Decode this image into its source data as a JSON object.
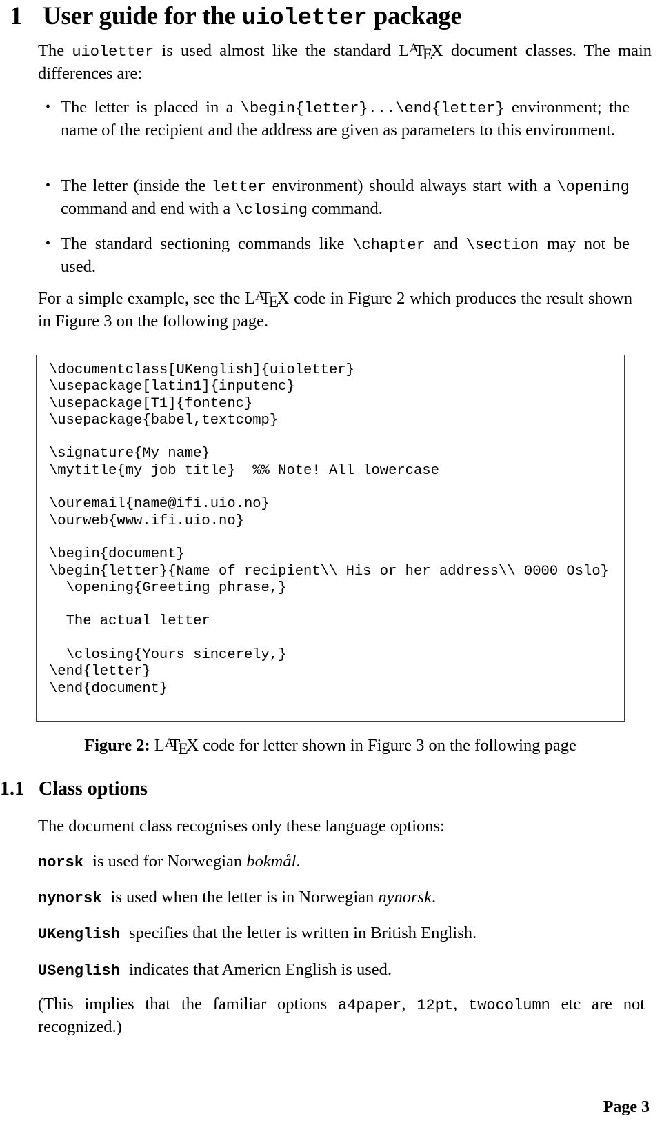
{
  "document": {
    "section": {
      "number": "1",
      "title_before": "User guide for the ",
      "title_mono": "uioletter",
      "title_after": " package"
    },
    "intro_paragraph": {
      "t1": "The ",
      "mono1": "uioletter",
      "t2": " is used almost like the standard ",
      "latex": "LaTeX",
      "t3": " document classes. The main differences are:"
    },
    "bullets": [
      {
        "t1": "The letter is placed in a ",
        "mono1": "\\begin{letter}...\\end{letter}",
        "t2": " environment; the name of the recipient and the address are given as parameters to this environment."
      },
      {
        "t1": "The letter (inside the ",
        "mono1": "letter",
        "t2": " environment) should always start with a ",
        "mono2": "\\opening",
        "t3": " command and end with a ",
        "mono3": "\\closing",
        "t4": " command."
      },
      {
        "t1": "The standard sectioning commands like ",
        "mono1": "\\chapter",
        "t2": " and ",
        "mono2": "\\section",
        "t3": " may not be used."
      }
    ],
    "figure_reference_paragraph": {
      "t1": "For a simple example, see the ",
      "latex": "LaTeX",
      "t2": " code in Figure 2 which produces the result shown in Figure 3 on the following page."
    },
    "figure": {
      "code": "\\documentclass[UKenglish]{uioletter}\n\\usepackage[latin1]{inputenc}\n\\usepackage[T1]{fontenc}\n\\usepackage{babel,textcomp}\n\n\\signature{My name}\n\\mytitle{my job title}  %% Note! All lowercase\n\n\\ouremail{name@ifi.uio.no}\n\\ourweb{www.ifi.uio.no}\n\n\\begin{document}\n\\begin{letter}{Name of recipient\\\\ His or her address\\\\ 0000 Oslo}\n  \\opening{Greeting phrase,}\n\n  The actual letter\n\n  \\closing{Yours sincerely,}\n\\end{letter}\n\\end{document}",
      "caption_label": "Figure 2:",
      "caption_t1": " ",
      "caption_latex": "LaTeX",
      "caption_t2": " code for letter shown in Figure 3 on the following page"
    },
    "subsection": {
      "number": "1.1",
      "title": "Class options"
    },
    "options_intro": "The document class recognises only these language options:",
    "options": [
      {
        "term": "norsk",
        "t1": " is used for Norwegian ",
        "em": "bokmål",
        "t2": "."
      },
      {
        "term": "nynorsk",
        "t1": " is used when the letter is in Norwegian ",
        "em": "nynorsk",
        "t2": "."
      },
      {
        "term": "UKenglish",
        "t1": " specifies that the letter is written in British English.",
        "em": "",
        "t2": ""
      },
      {
        "term": "USenglish",
        "t1": " indicates that Americn English is used.",
        "em": "",
        "t2": ""
      }
    ],
    "closing_paragraph": {
      "t1": "(This implies that the familiar options ",
      "mono1": "a4paper",
      "t2": ", ",
      "mono2": "12pt",
      "t3": ", ",
      "mono3": "twocolumn",
      "t4": " etc are not recognized.)"
    },
    "footer": "Page 3"
  }
}
